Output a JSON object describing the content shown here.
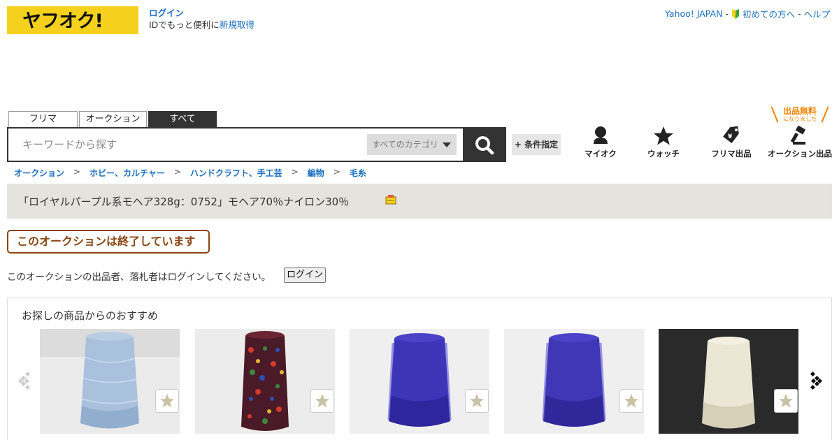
{
  "header": {
    "logo_text": "ヤフオク!",
    "login_link": "ログイン",
    "id_text": "IDでもっと便利に",
    "signup_link": "新規取得",
    "yahoo_link": "Yahoo! JAPAN",
    "sep1": "-",
    "beginner_link": "初めての方へ",
    "sep2": "-",
    "help_link": "ヘルプ"
  },
  "search": {
    "tabs": [
      "フリマ",
      "オークション",
      "すべて"
    ],
    "active_tab": "すべて",
    "placeholder": "キーワードから探す",
    "category": "すべてのカテゴリ",
    "condition_button": "+ 条件指定"
  },
  "free_listing": {
    "big": "出品無料",
    "small": "になりました"
  },
  "nav": {
    "myauc": "マイオク",
    "watch": "ウォッチ",
    "flea_listing": "フリマ出品",
    "auction_listing": "オークション出品"
  },
  "breadcrumb": [
    "オークション",
    "ホビー、カルチャー",
    "ハンドクラフト、手工芸",
    "編物",
    "毛糸"
  ],
  "breadcrumb_sep": ">",
  "item": {
    "title": "「ロイヤルパープル系モヘア328g：0752」モヘア70％ナイロン30％"
  },
  "status": {
    "ended": "このオークションは終了しています",
    "login_note": "このオークションの出品者、落札者はログインしてください。",
    "login_button": "ログイン"
  },
  "recommend": {
    "title": "お探しの商品からのおすすめ",
    "items": [
      {
        "color": "#a9c1dc",
        "shade": "#7f9ec2",
        "bg": "#ebebeb",
        "kind": "light-blue"
      },
      {
        "color": "#5a1f2c",
        "shade": "#2a0f18",
        "bg": "#ececec",
        "kind": "multicolor"
      },
      {
        "color": "#3d35b8",
        "shade": "#241c8a",
        "bg": "#efefef",
        "kind": "purple-mohair"
      },
      {
        "color": "#3f37b5",
        "shade": "#261e88",
        "bg": "#efefef",
        "kind": "purple-mohair"
      },
      {
        "color": "#ece6d4",
        "shade": "#cfc6ae",
        "bg": "#2a2a2a",
        "kind": "cream"
      }
    ]
  },
  "colors": {
    "logo_bg": "#f5d11e",
    "link": "#1a6fc0",
    "ended": "#8b4513",
    "free": "#f08300",
    "title_bar": "#e4e3dd"
  }
}
